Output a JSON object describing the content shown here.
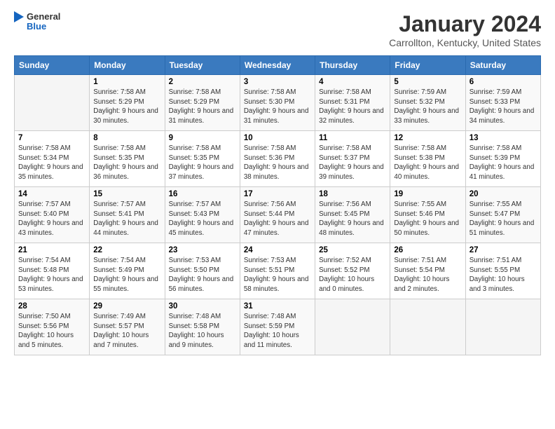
{
  "header": {
    "logo_general": "General",
    "logo_blue": "Blue",
    "month": "January 2024",
    "location": "Carrollton, Kentucky, United States"
  },
  "weekdays": [
    "Sunday",
    "Monday",
    "Tuesday",
    "Wednesday",
    "Thursday",
    "Friday",
    "Saturday"
  ],
  "weeks": [
    [
      {
        "day": "",
        "empty": true
      },
      {
        "day": "1",
        "sunrise": "Sunrise: 7:58 AM",
        "sunset": "Sunset: 5:29 PM",
        "daylight": "Daylight: 9 hours and 30 minutes."
      },
      {
        "day": "2",
        "sunrise": "Sunrise: 7:58 AM",
        "sunset": "Sunset: 5:29 PM",
        "daylight": "Daylight: 9 hours and 31 minutes."
      },
      {
        "day": "3",
        "sunrise": "Sunrise: 7:58 AM",
        "sunset": "Sunset: 5:30 PM",
        "daylight": "Daylight: 9 hours and 31 minutes."
      },
      {
        "day": "4",
        "sunrise": "Sunrise: 7:58 AM",
        "sunset": "Sunset: 5:31 PM",
        "daylight": "Daylight: 9 hours and 32 minutes."
      },
      {
        "day": "5",
        "sunrise": "Sunrise: 7:59 AM",
        "sunset": "Sunset: 5:32 PM",
        "daylight": "Daylight: 9 hours and 33 minutes."
      },
      {
        "day": "6",
        "sunrise": "Sunrise: 7:59 AM",
        "sunset": "Sunset: 5:33 PM",
        "daylight": "Daylight: 9 hours and 34 minutes."
      }
    ],
    [
      {
        "day": "7",
        "sunrise": "Sunrise: 7:58 AM",
        "sunset": "Sunset: 5:34 PM",
        "daylight": "Daylight: 9 hours and 35 minutes."
      },
      {
        "day": "8",
        "sunrise": "Sunrise: 7:58 AM",
        "sunset": "Sunset: 5:35 PM",
        "daylight": "Daylight: 9 hours and 36 minutes."
      },
      {
        "day": "9",
        "sunrise": "Sunrise: 7:58 AM",
        "sunset": "Sunset: 5:35 PM",
        "daylight": "Daylight: 9 hours and 37 minutes."
      },
      {
        "day": "10",
        "sunrise": "Sunrise: 7:58 AM",
        "sunset": "Sunset: 5:36 PM",
        "daylight": "Daylight: 9 hours and 38 minutes."
      },
      {
        "day": "11",
        "sunrise": "Sunrise: 7:58 AM",
        "sunset": "Sunset: 5:37 PM",
        "daylight": "Daylight: 9 hours and 39 minutes."
      },
      {
        "day": "12",
        "sunrise": "Sunrise: 7:58 AM",
        "sunset": "Sunset: 5:38 PM",
        "daylight": "Daylight: 9 hours and 40 minutes."
      },
      {
        "day": "13",
        "sunrise": "Sunrise: 7:58 AM",
        "sunset": "Sunset: 5:39 PM",
        "daylight": "Daylight: 9 hours and 41 minutes."
      }
    ],
    [
      {
        "day": "14",
        "sunrise": "Sunrise: 7:57 AM",
        "sunset": "Sunset: 5:40 PM",
        "daylight": "Daylight: 9 hours and 43 minutes."
      },
      {
        "day": "15",
        "sunrise": "Sunrise: 7:57 AM",
        "sunset": "Sunset: 5:41 PM",
        "daylight": "Daylight: 9 hours and 44 minutes."
      },
      {
        "day": "16",
        "sunrise": "Sunrise: 7:57 AM",
        "sunset": "Sunset: 5:43 PM",
        "daylight": "Daylight: 9 hours and 45 minutes."
      },
      {
        "day": "17",
        "sunrise": "Sunrise: 7:56 AM",
        "sunset": "Sunset: 5:44 PM",
        "daylight": "Daylight: 9 hours and 47 minutes."
      },
      {
        "day": "18",
        "sunrise": "Sunrise: 7:56 AM",
        "sunset": "Sunset: 5:45 PM",
        "daylight": "Daylight: 9 hours and 48 minutes."
      },
      {
        "day": "19",
        "sunrise": "Sunrise: 7:55 AM",
        "sunset": "Sunset: 5:46 PM",
        "daylight": "Daylight: 9 hours and 50 minutes."
      },
      {
        "day": "20",
        "sunrise": "Sunrise: 7:55 AM",
        "sunset": "Sunset: 5:47 PM",
        "daylight": "Daylight: 9 hours and 51 minutes."
      }
    ],
    [
      {
        "day": "21",
        "sunrise": "Sunrise: 7:54 AM",
        "sunset": "Sunset: 5:48 PM",
        "daylight": "Daylight: 9 hours and 53 minutes."
      },
      {
        "day": "22",
        "sunrise": "Sunrise: 7:54 AM",
        "sunset": "Sunset: 5:49 PM",
        "daylight": "Daylight: 9 hours and 55 minutes."
      },
      {
        "day": "23",
        "sunrise": "Sunrise: 7:53 AM",
        "sunset": "Sunset: 5:50 PM",
        "daylight": "Daylight: 9 hours and 56 minutes."
      },
      {
        "day": "24",
        "sunrise": "Sunrise: 7:53 AM",
        "sunset": "Sunset: 5:51 PM",
        "daylight": "Daylight: 9 hours and 58 minutes."
      },
      {
        "day": "25",
        "sunrise": "Sunrise: 7:52 AM",
        "sunset": "Sunset: 5:52 PM",
        "daylight": "Daylight: 10 hours and 0 minutes."
      },
      {
        "day": "26",
        "sunrise": "Sunrise: 7:51 AM",
        "sunset": "Sunset: 5:54 PM",
        "daylight": "Daylight: 10 hours and 2 minutes."
      },
      {
        "day": "27",
        "sunrise": "Sunrise: 7:51 AM",
        "sunset": "Sunset: 5:55 PM",
        "daylight": "Daylight: 10 hours and 3 minutes."
      }
    ],
    [
      {
        "day": "28",
        "sunrise": "Sunrise: 7:50 AM",
        "sunset": "Sunset: 5:56 PM",
        "daylight": "Daylight: 10 hours and 5 minutes."
      },
      {
        "day": "29",
        "sunrise": "Sunrise: 7:49 AM",
        "sunset": "Sunset: 5:57 PM",
        "daylight": "Daylight: 10 hours and 7 minutes."
      },
      {
        "day": "30",
        "sunrise": "Sunrise: 7:48 AM",
        "sunset": "Sunset: 5:58 PM",
        "daylight": "Daylight: 10 hours and 9 minutes."
      },
      {
        "day": "31",
        "sunrise": "Sunrise: 7:48 AM",
        "sunset": "Sunset: 5:59 PM",
        "daylight": "Daylight: 10 hours and 11 minutes."
      },
      {
        "day": "",
        "empty": true
      },
      {
        "day": "",
        "empty": true
      },
      {
        "day": "",
        "empty": true
      }
    ]
  ]
}
